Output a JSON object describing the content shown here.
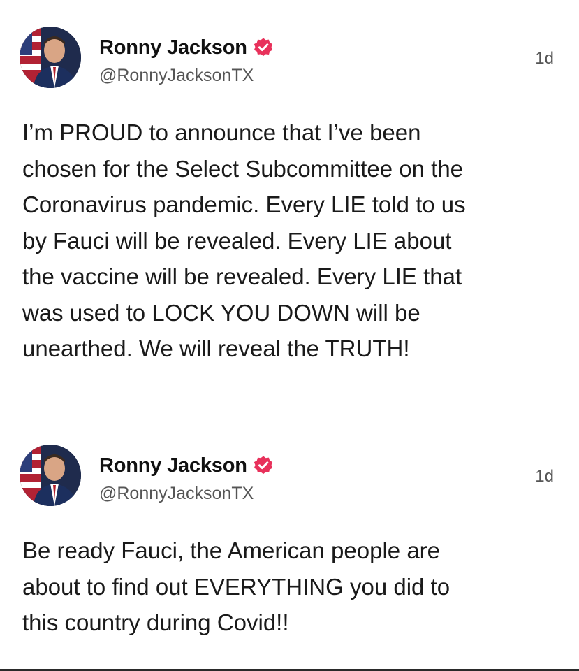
{
  "posts": [
    {
      "author": {
        "display_name": "Ronny Jackson",
        "handle": "@RonnyJacksonTX",
        "avatar_icon": "profile-photo",
        "verified_icon": "verified-badge-icon"
      },
      "timestamp": "1d",
      "body_lines": [
        "I’m PROUD to announce that I’ve been",
        "chosen for the Select Subcommittee on the",
        "Coronavirus pandemic. Every LIE told to us",
        "by Fauci will be revealed. Every LIE about",
        "the vaccine will be revealed. Every LIE that",
        "was used to LOCK YOU DOWN will be",
        "unearthed. We will reveal the TRUTH!"
      ]
    },
    {
      "author": {
        "display_name": "Ronny Jackson",
        "handle": "@RonnyJacksonTX",
        "avatar_icon": "profile-photo",
        "verified_icon": "verified-badge-icon"
      },
      "timestamp": "1d",
      "body_lines": [
        "Be ready Fauci, the American people are",
        "about to find out EVERYTHING you did to",
        "this country during Covid!!"
      ]
    }
  ],
  "colors": {
    "verified_badge": "#e8315b",
    "text": "#1a1a1a",
    "secondary_text": "#555555",
    "background": "#ffffff"
  }
}
